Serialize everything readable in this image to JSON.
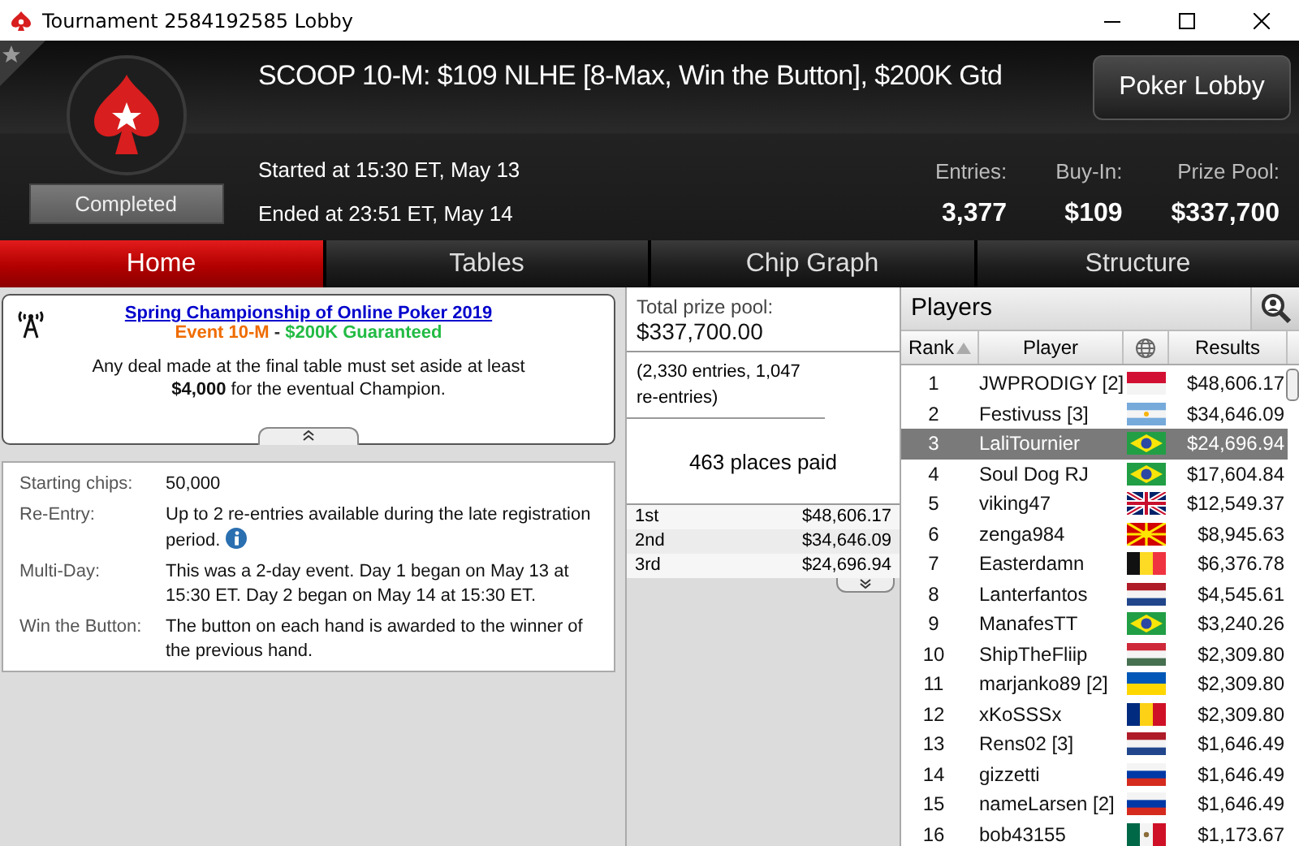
{
  "window": {
    "title": "Tournament 2584192585 Lobby"
  },
  "header": {
    "title": "SCOOP 10-M: $109 NLHE [8-Max, Win the Button], $200K Gtd",
    "started": "Started at 15:30 ET, May 13",
    "ended": "Ended at 23:51 ET, May 14",
    "status": "Completed",
    "button": "Poker Lobby",
    "stats": [
      {
        "label": "Entries:",
        "value": "3,377"
      },
      {
        "label": "Buy-In:",
        "value": "$109"
      },
      {
        "label": "Prize Pool:",
        "value": "$337,700"
      }
    ]
  },
  "tabs": [
    {
      "label": "Home",
      "selected": true
    },
    {
      "label": "Tables",
      "selected": false
    },
    {
      "label": "Chip Graph",
      "selected": false
    },
    {
      "label": "Structure",
      "selected": false
    }
  ],
  "announcement": {
    "link": "Spring Championship of Online Poker 2019",
    "event": "Event 10-M",
    "separator": "-",
    "guarantee": "$200K Guaranteed",
    "text": "Any deal made at the final table must set aside at least **$4,000** for the eventual Champion."
  },
  "details": [
    {
      "label": "Starting chips:",
      "value": "50,000",
      "info": false
    },
    {
      "label": "Re-Entry:",
      "value": "Up to 2 re-entries available during the late registration period.",
      "info": true
    },
    {
      "label": "Multi-Day:",
      "value": "This was a 2-day event. Day 1 began on May 13 at 15:30 ET. Day 2 began on May 14 at 15:30 ET.",
      "info": false
    },
    {
      "label": "Win the Button:",
      "value": "The button on each hand is awarded to the winner of the previous hand.",
      "info": false
    }
  ],
  "prize_pool": {
    "label": "Total prize pool:",
    "amount": "$337,700.00",
    "note": "(2,330 entries, 1,047 re-entries)",
    "places_paid": "463 places paid",
    "payouts": [
      {
        "place": "1st",
        "amount": "$48,606.17"
      },
      {
        "place": "2nd",
        "amount": "$34,646.09"
      },
      {
        "place": "3rd",
        "amount": "$24,696.94"
      }
    ]
  },
  "players": {
    "title": "Players",
    "columns": [
      {
        "kind": "text",
        "label": "Rank",
        "sorted": true
      },
      {
        "kind": "text",
        "label": "Player",
        "sorted": false
      },
      {
        "kind": "icon"
      },
      {
        "kind": "text",
        "label": "Results",
        "sorted": false
      }
    ],
    "rows": [
      {
        "rank": "1",
        "name": "JWPRODIGY [2]",
        "kind": "indonesia",
        "result": "$48,606.17",
        "selected": false
      },
      {
        "rank": "2",
        "name": "Festivuss [3]",
        "kind": "argentina",
        "result": "$34,646.09",
        "selected": false
      },
      {
        "rank": "3",
        "name": "LaliTournier",
        "kind": "brazil",
        "result": "$24,696.94",
        "selected": true
      },
      {
        "rank": "4",
        "name": "Soul Dog RJ",
        "kind": "brazil",
        "result": "$17,604.84",
        "selected": false
      },
      {
        "rank": "5",
        "name": "viking47",
        "kind": "uk",
        "result": "$12,549.37",
        "selected": false
      },
      {
        "rank": "6",
        "name": "zenga984",
        "kind": "macedonia",
        "result": "$8,945.63",
        "selected": false
      },
      {
        "rank": "7",
        "name": "Easterdamn",
        "kind": "belgium",
        "result": "$6,376.78",
        "selected": false
      },
      {
        "rank": "8",
        "name": "Lanterfantos",
        "kind": "netherlands",
        "result": "$4,545.61",
        "selected": false
      },
      {
        "rank": "9",
        "name": "ManafesTT",
        "kind": "brazil",
        "result": "$3,240.26",
        "selected": false
      },
      {
        "rank": "10",
        "name": "ShipTheFliip",
        "kind": "hungary",
        "result": "$2,309.80",
        "selected": false
      },
      {
        "rank": "11",
        "name": "marjanko89 [2]",
        "kind": "ukraine",
        "result": "$2,309.80",
        "selected": false
      },
      {
        "rank": "12",
        "name": "xKoSSSx",
        "kind": "romania",
        "result": "$2,309.80",
        "selected": false
      },
      {
        "rank": "13",
        "name": "Rens02 [3]",
        "kind": "netherlands",
        "result": "$1,646.49",
        "selected": false
      },
      {
        "rank": "14",
        "name": "gizzetti",
        "kind": "russia",
        "result": "$1,646.49",
        "selected": false
      },
      {
        "rank": "15",
        "name": "nameLarsen [2]",
        "kind": "russia",
        "result": "$1,646.49",
        "selected": false
      },
      {
        "rank": "16",
        "name": "bob43155",
        "kind": "mexico",
        "result": "$1,173.67",
        "selected": false
      }
    ]
  }
}
